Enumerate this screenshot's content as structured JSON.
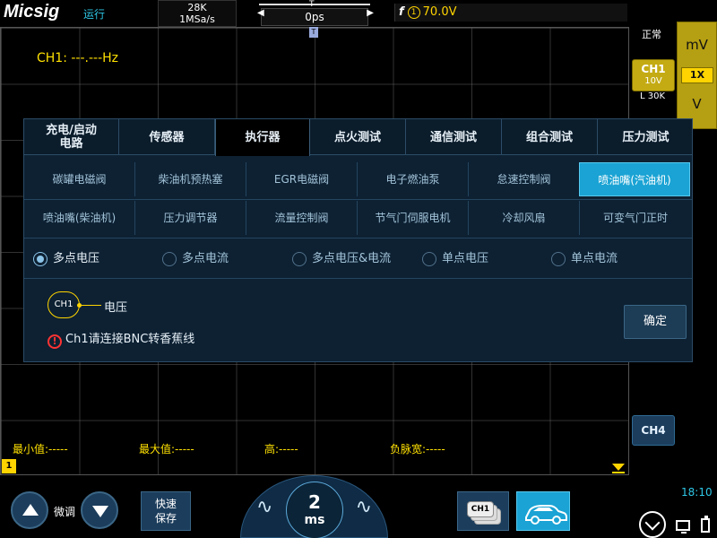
{
  "app": {
    "logo": "Micsig",
    "run_status": "运行",
    "mode": "正常",
    "clock": "18:10"
  },
  "acquisition": {
    "memory_depth": "28K",
    "sample_rate": "1MSa/s"
  },
  "timeline": {
    "delay": "0ps",
    "marker": "T"
  },
  "trigger": {
    "edge_symbol": "f",
    "channel_num": "1",
    "level": "70.0V"
  },
  "scope": {
    "frequency_readout": "CH1: ---.---Hz",
    "ch1_ground_marker": "1",
    "trigger_pos_marker": "T"
  },
  "measurements": [
    {
      "label": "最小值:-----"
    },
    {
      "label": "最大值:-----"
    },
    {
      "label": "高:-----"
    },
    {
      "label": "负脉宽:-----"
    }
  ],
  "right_panel": {
    "unit_top": "mV",
    "probe": "1X",
    "unit_bottom": "V",
    "ch1_label": "CH1",
    "ch1_scale": "10V",
    "ch1_length": "L 30K",
    "ch4_label": "CH4"
  },
  "dialog": {
    "tabs": [
      {
        "label": "充电/启动\n电路"
      },
      {
        "label": "传感器"
      },
      {
        "label": "执行器"
      },
      {
        "label": "点火测试"
      },
      {
        "label": "通信测试"
      },
      {
        "label": "组合测试"
      },
      {
        "label": "压力测试"
      }
    ],
    "active_tab": 2,
    "sub_items_row1": [
      "碳罐电磁阀",
      "柴油机预热塞",
      "EGR电磁阀",
      "电子燃油泵",
      "怠速控制阀",
      "喷油嘴(汽油机)"
    ],
    "sub_items_row2": [
      "喷油嘴(柴油机)",
      "压力调节器",
      "流量控制阀",
      "节气门伺服电机",
      "冷却风扇",
      "可变气门正时"
    ],
    "active_sub": "喷油嘴(汽油机)",
    "modes": [
      "多点电压",
      "多点电流",
      "多点电压&电流",
      "单点电压",
      "单点电流"
    ],
    "selected_mode": 0,
    "connector_label": "CH1",
    "connector_signal": "电压",
    "warning_icon": "!",
    "warning": "Ch1请连接BNC转香蕉线",
    "confirm_label": "确定"
  },
  "bottom": {
    "fine_label": "微调",
    "save_label_1": "快速",
    "save_label_2": "保存",
    "timebase_value": "2",
    "timebase_unit": "ms",
    "wave_left": "∿",
    "wave_right": "∿",
    "stack_label": "CH1"
  },
  "colors": {
    "accent": "#1aa3d4",
    "trace_yellow": "#ffd400",
    "panel_bg": "#0d2133"
  }
}
